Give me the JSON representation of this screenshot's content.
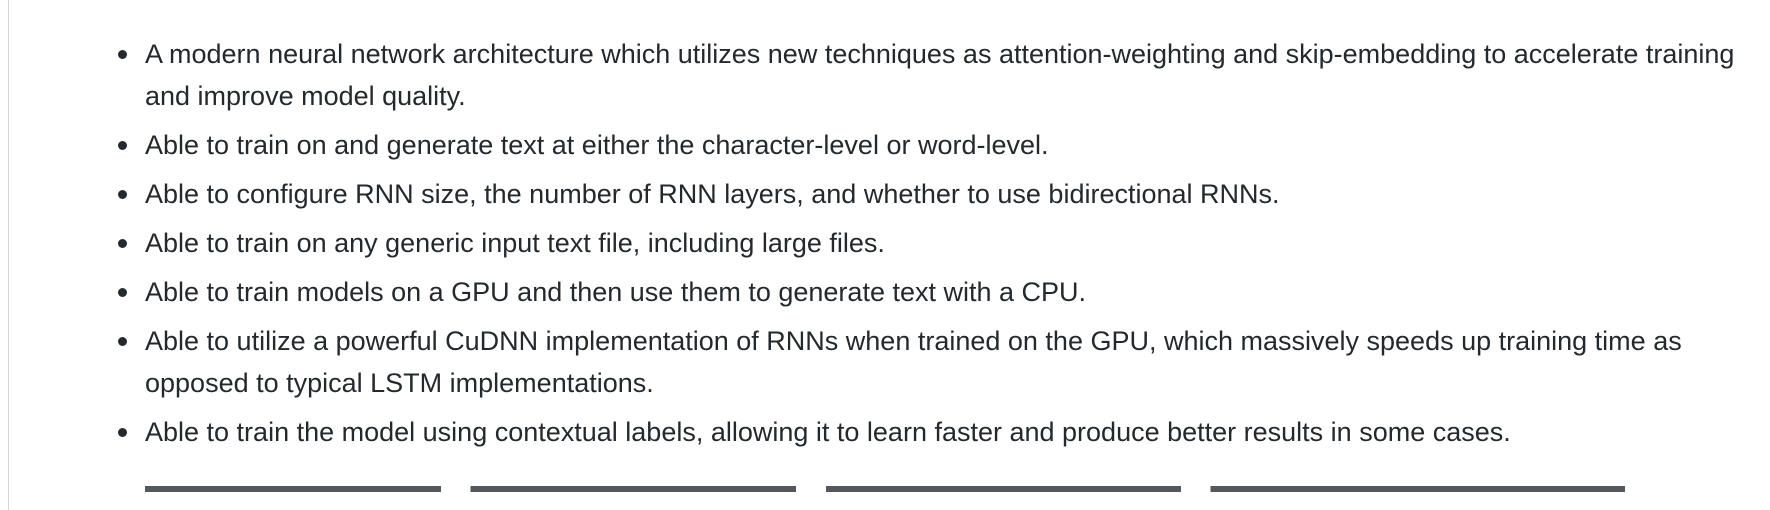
{
  "features": {
    "items": [
      "A modern neural network architecture which utilizes new techniques as attention-weighting and skip-embedding to accelerate training and improve model quality.",
      "Able to train on and generate text at either the character-level or word-level.",
      "Able to configure RNN size, the number of RNN layers, and whether to use bidirectional RNNs.",
      "Able to train on any generic input text file, including large files.",
      "Able to train models on a GPU and then use them to generate text with a CPU.",
      "Able to utilize a powerful CuDNN implementation of RNNs when trained on the GPU, which massively speeds up training time as opposed to typical LSTM implementations.",
      "Able to train the model using contextual labels, allowing it to learn faster and produce better results in some cases."
    ]
  }
}
